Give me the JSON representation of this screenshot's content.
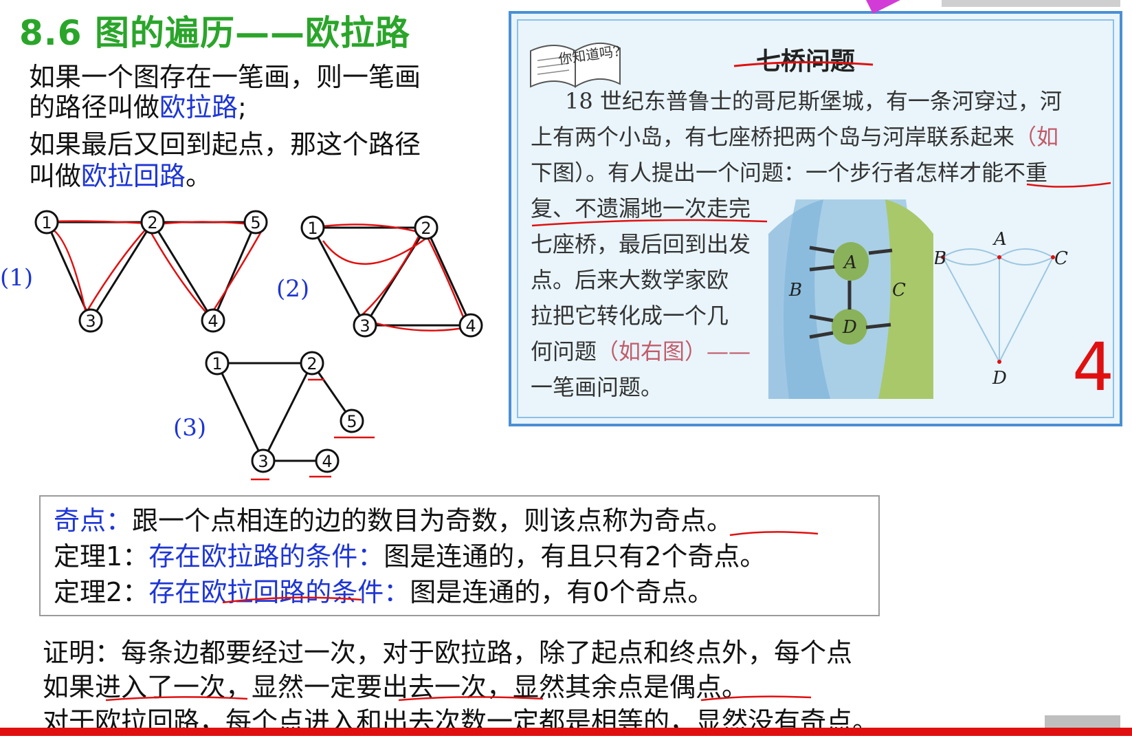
{
  "title": "8.6 图的遍历——欧拉路",
  "definition": {
    "line1": "如果一个图存在一笔画，则一笔画",
    "line2_pre": "的路径叫做",
    "line2_term": "欧拉路",
    "line2_post": ";",
    "line3": "如果最后又回到起点，那这个路径",
    "line4_pre": "叫做",
    "line4_term": "欧拉回路",
    "line4_post": "。"
  },
  "graphs": {
    "label1": "(1)",
    "label2": "(2)",
    "label3": "(3)",
    "nodes": [
      "1",
      "2",
      "3",
      "4",
      "5"
    ]
  },
  "story": {
    "book_label": "你知道吗?",
    "title": "七桥问题",
    "lines": [
      "18 世纪东普鲁士的哥尼斯堡城，有一条河穿过，河",
      "上有两个小岛，有七座桥把两个岛与河岸联系起来",
      "下图）。有人提出一个问题：一个步行者怎样才能不重",
      "复、不遗漏地一次走完",
      "七座桥，最后回到出发",
      "点。后来大数学家欧",
      "拉把它转化成一个几",
      "何问题",
      "一笔画问题。"
    ],
    "line2_tail": "（如",
    "line7_tail": "（如右图）——",
    "map_labels": {
      "A": "A",
      "B": "B",
      "C": "C",
      "D": "D"
    },
    "graph_labels": {
      "A": "A",
      "B": "B",
      "C": "C",
      "D": "D"
    },
    "handwritten": "4"
  },
  "theorem": {
    "odd_label": "奇点：",
    "odd_text": "跟一个点相连的边的数目为奇数，则该点称为奇点。",
    "t1_label": "定理1：",
    "t1_cond": "存在欧拉路的条件：",
    "t1_text": "图是连通的，有且只有2个奇点。",
    "t2_label": "定理2：",
    "t2_cond": "存在欧拉回路的条件：",
    "t2_text": "图是连通的，有0个奇点。"
  },
  "proof": {
    "line1": "证明：每条边都要经过一次，对于欧拉路，除了起点和终点外，每个点",
    "line2": "如果进入了一次，显然一定要出去一次，显然其余点是偶点。",
    "line3": "对于欧拉回路，每个点进入和出去次数一定都是相等的，显然没有奇点。"
  },
  "colors": {
    "title": "#2aa52a",
    "term": "#1d35d6",
    "annotation": "#e01010",
    "box_border": "#4b8fd4"
  }
}
